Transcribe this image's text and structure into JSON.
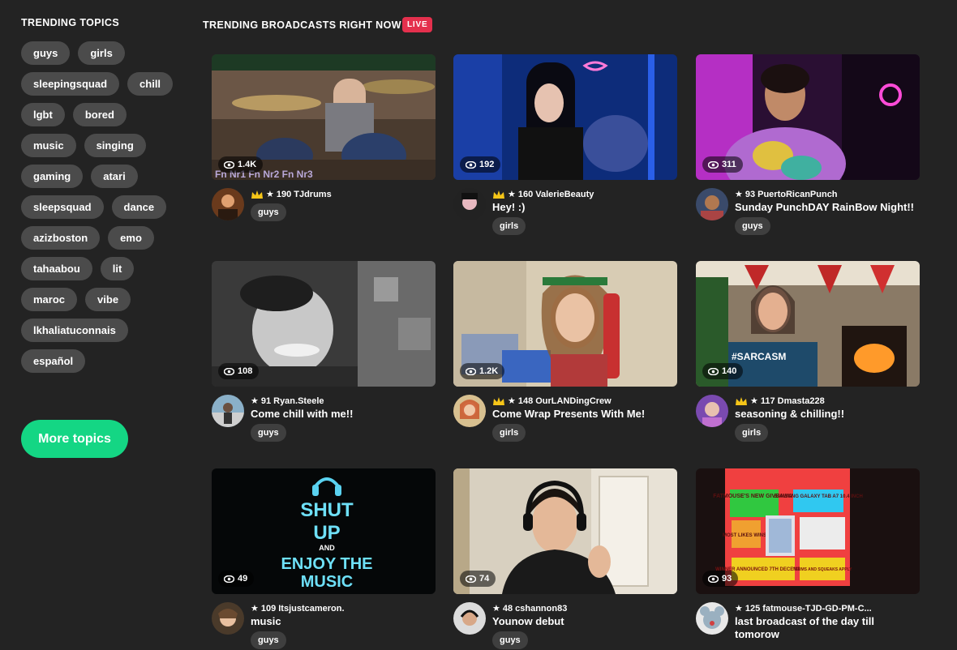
{
  "sidebar": {
    "title": "TRENDING TOPICS",
    "topics": [
      "guys",
      "girls",
      "sleepingsquad",
      "chill",
      "lgbt",
      "bored",
      "music",
      "singing",
      "gaming",
      "atari",
      "sleepsquad",
      "dance",
      "azizboston",
      "emo",
      "tahaabou",
      "lit",
      "maroc",
      "vibe",
      "lkhaliatuconnais",
      "español"
    ],
    "more_label": "More topics"
  },
  "main": {
    "title": "TRENDING BROADCASTS RIGHT NOW",
    "live_label": "LIVE"
  },
  "colors": {
    "background": "#232323",
    "pill": "#4b4b4b",
    "more_button": "#14d684",
    "live_badge": "#e4304d"
  },
  "broadcasts": [
    {
      "viewers": "1.4K",
      "badge": "crown-icon",
      "score": "190",
      "username": "TJdrums",
      "title": "",
      "tag": "guys"
    },
    {
      "viewers": "192",
      "badge": "crown-icon",
      "score": "160",
      "username": "ValerieBeauty",
      "title": "Hey! :)",
      "tag": "girls"
    },
    {
      "viewers": "311",
      "badge": "",
      "score": "93",
      "username": "PuertoRicanPunch",
      "title": "Sunday PunchDAY RainBow Night!!",
      "tag": "guys"
    },
    {
      "viewers": "108",
      "badge": "",
      "score": "91",
      "username": "Ryan.Steele",
      "title": "Come chill with me!!",
      "tag": "guys"
    },
    {
      "viewers": "1.2K",
      "badge": "crown-icon",
      "score": "148",
      "username": "OurLANDingCrew",
      "title": "Come Wrap Presents With Me!",
      "tag": "girls"
    },
    {
      "viewers": "140",
      "badge": "crown-icon",
      "score": "117",
      "username": "Dmasta228",
      "title": "seasoning & chilling!!",
      "tag": "girls"
    },
    {
      "viewers": "49",
      "badge": "",
      "score": "109",
      "username": "Itsjustcameron.",
      "title": "music",
      "tag": "guys"
    },
    {
      "viewers": "74",
      "badge": "",
      "score": "48",
      "username": "cshannon83",
      "title": "Younow debut",
      "tag": "guys"
    },
    {
      "viewers": "93",
      "badge": "",
      "score": "125",
      "username": "fatmouse-TJD-GD-PM-C...",
      "title": "last broadcast of the day till tomorow",
      "tag": ""
    }
  ],
  "thumb_text": {
    "shut": "SHUT",
    "up": "UP",
    "and": "AND",
    "enjoy": "ENJOY THE",
    "music": "MUSIC",
    "sarcasm": "#SARCASM",
    "giveaway_1": "FATMOUSE'S NEW GIVEAWAY",
    "giveaway_2": "SAMSUNG GALAXY TAB A7 10.4 INCH",
    "giveaway_3": "MOST LIKES WINS!!",
    "giveaway_4": "WINNER ANNOUNCED 7TH DECEMBER!!",
    "giveaway_5": "TERMS AND SQUEAKS APPLY",
    "drum_overlay": "Fn Nr1 Fn Nr2 Fn Nr3"
  }
}
